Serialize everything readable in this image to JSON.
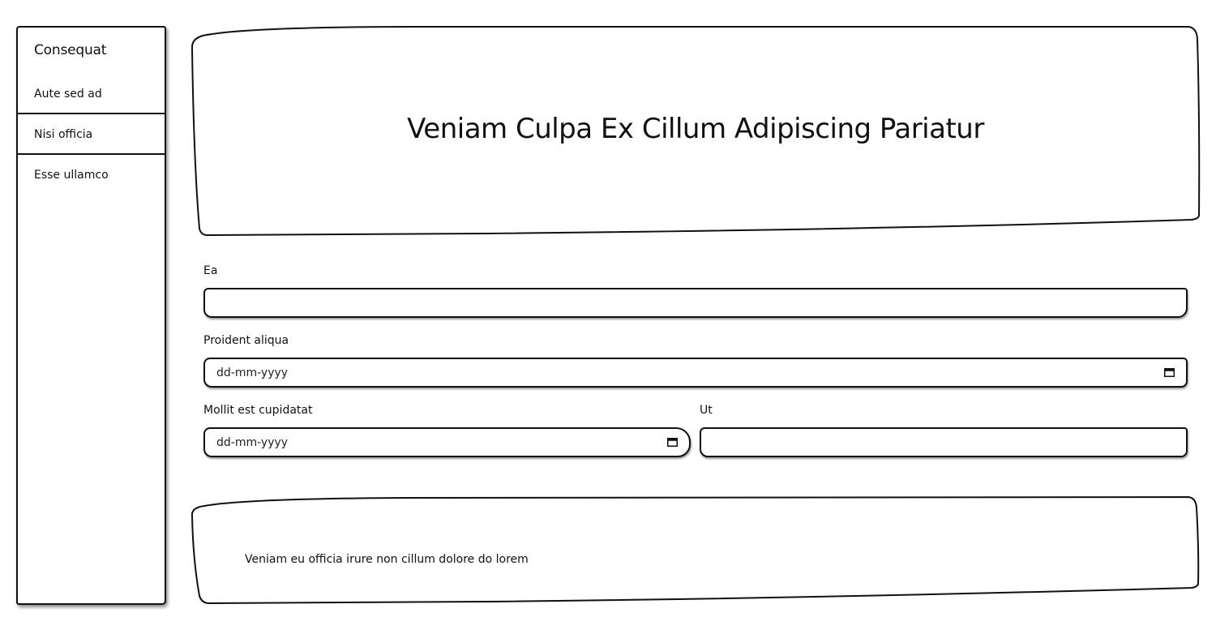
{
  "sidebar": {
    "title": "Consequat",
    "items": [
      {
        "label": "Aute sed ad"
      },
      {
        "label": "Nisi officia"
      },
      {
        "label": "Esse ullamco"
      }
    ]
  },
  "header": {
    "title": "Veniam Culpa Ex Cillum Adipiscing Pariatur"
  },
  "form": {
    "field_ea": {
      "label": "Ea",
      "value": ""
    },
    "field_proident": {
      "label": "Proident aliqua",
      "value": "dd-mm-yyyy"
    },
    "field_mollit": {
      "label": "Mollit est cupidatat",
      "value": "dd-mm-yyyy"
    },
    "field_ut": {
      "label": "Ut",
      "value": ""
    }
  },
  "footer": {
    "text": "Veniam eu officia irure non cillum dolore do lorem"
  },
  "icons": {
    "date_picker": "calendar-icon"
  }
}
